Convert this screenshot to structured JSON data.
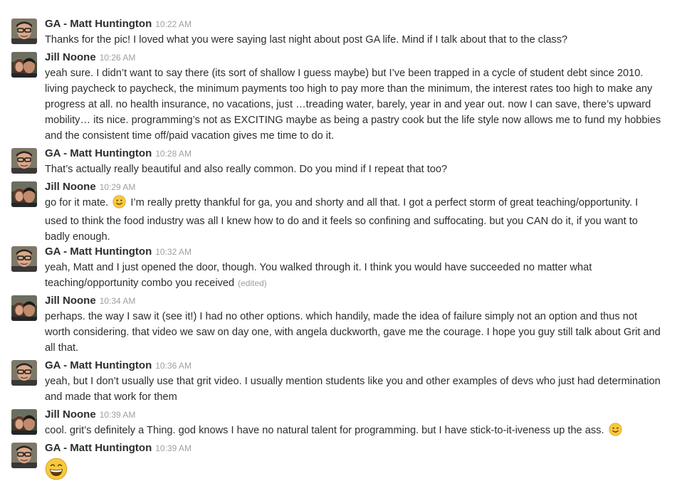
{
  "messages": [
    {
      "author": "GA - Matt Huntington",
      "time": "10:22 AM",
      "avatar": "matt",
      "lines": [
        "Thanks for the pic!  I loved what you were saying last night about post GA life.  Mind if I talk about that to the class?"
      ]
    },
    {
      "author": "Jill Noone",
      "time": "10:26 AM",
      "avatar": "jill",
      "lines": [
        "yeah sure. I didn’t want to say there (its sort of shallow I guess maybe) but I’ve been trapped in a cycle of student debt since 2010.",
        "living paycheck to paycheck, the minimum payments too high to pay more than the minimum, the interest rates too high to make any",
        "progress at all. no health insurance, no vacations, just …treading water, barely, year in and year out. now I can save, there’s upward",
        "mobility… its nice. programming’s not as EXCITING maybe as being a pastry cook but the life style now allows me to fund my hobbies",
        "and the consistent time off/paid vacation gives me time to do it."
      ]
    },
    {
      "author": "GA - Matt Huntington",
      "time": "10:28 AM",
      "avatar": "matt",
      "lines": [
        "That’s actually really beautiful and also really common.  Do you mind if I repeat that too?"
      ]
    },
    {
      "author": "Jill Noone",
      "time": "10:29 AM",
      "avatar": "jill",
      "line1_before": "go for it mate.",
      "line1_after": "I’m really pretty thankful for ga, you and shorty and all that. I got a perfect storm of great teaching/opportunity. I",
      "lines": [
        "used to think the food industry was all I knew how to do and it feels so confining and suffocating. but you CAN do it, if you want to",
        "badly enough."
      ]
    },
    {
      "author": "GA - Matt Huntington",
      "time": "10:32 AM",
      "avatar": "matt",
      "lines": [
        "yeah, Matt and I just opened the door, though.  You walked through it.  I think you would have succeeded no matter what",
        "teaching/opportunity combo you received"
      ],
      "edited": "(edited)"
    },
    {
      "author": "Jill Noone",
      "time": "10:34 AM",
      "avatar": "jill",
      "lines": [
        "perhaps. the way I saw it (see it!) I had no other options. which handily, made the idea of failure simply not an option and thus not",
        "worth considering. that video we saw on day one, with angela duckworth, gave me the courage. I hope you guy still talk about Grit and",
        "all that."
      ]
    },
    {
      "author": "GA - Matt Huntington",
      "time": "10:36 AM",
      "avatar": "matt",
      "lines": [
        "yeah, but I don’t usually use that grit video.  I usually mention students like you and other examples of devs who just had determination",
        "and made that work for them"
      ]
    },
    {
      "author": "Jill Noone",
      "time": "10:39 AM",
      "avatar": "jill",
      "line1_before": "cool. grit’s definitely a Thing. god knows I have no natural talent for programming. but I have stick-to-it-iveness up the ass."
    },
    {
      "author": "GA - Matt Huntington",
      "time": "10:39 AM",
      "avatar": "matt",
      "emoji_only": "grinning-face"
    }
  ],
  "colors": {
    "text": "#2c2d30",
    "timestamp": "#9e9ea6",
    "emoji": "#f7c93e"
  }
}
